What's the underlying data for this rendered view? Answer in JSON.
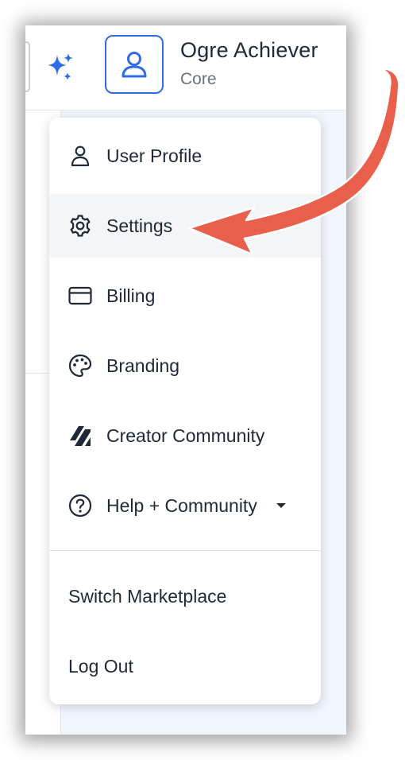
{
  "header": {
    "user_name": "Ogre Achiever",
    "user_plan": "Core"
  },
  "menu": {
    "items": [
      {
        "label": "User Profile",
        "icon": "user-icon"
      },
      {
        "label": "Settings",
        "icon": "gear-icon",
        "highlighted": true
      },
      {
        "label": "Billing",
        "icon": "credit-card-icon"
      },
      {
        "label": "Branding",
        "icon": "palette-icon"
      },
      {
        "label": "Creator Community",
        "icon": "community-logo-icon"
      },
      {
        "label": "Help + Community",
        "icon": "question-circle-icon",
        "has_submenu": true
      }
    ],
    "footer_items": [
      {
        "label": "Switch Marketplace"
      },
      {
        "label": "Log Out"
      }
    ]
  },
  "colors": {
    "accent": "#2f6ce5",
    "annotation_arrow": "#e8604c",
    "text": "#1f2937",
    "muted": "#6b7280",
    "content_background": "#f1f5fd"
  }
}
